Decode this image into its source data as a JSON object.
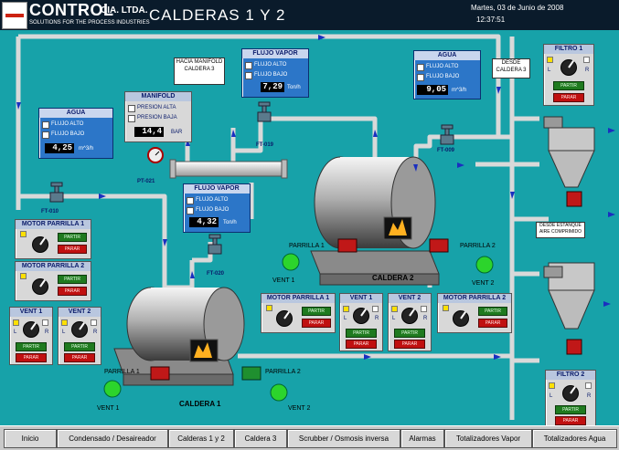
{
  "header": {
    "brand": "CONTROL",
    "brand_suffix": "CIA. LTDA.",
    "tagline": "SOLUTIONS FOR THE PROCESS INDUSTRIES",
    "title": "CALDERAS 1 Y 2",
    "date": "Martes, 03 de Junio de 2008",
    "time": "12:37:51"
  },
  "agua1": {
    "title": "AGUA",
    "opt_alto": "FLUJO ALTO",
    "opt_bajo": "FLUJO BAJO",
    "value": "4,25",
    "unit": "m^3/h"
  },
  "manifold": {
    "title": "MANIFOLD",
    "opt_alta": "PRESION ALTA",
    "opt_baja": "PRESION BAJA",
    "value": "14,4",
    "unit": "BAR"
  },
  "vapor1": {
    "title": "FLUJO VAPOR",
    "opt_alto": "FLUJO ALTO",
    "opt_bajo": "FLUJO BAJO",
    "value": "7,29",
    "unit": "Ton/h"
  },
  "vapor2": {
    "title": "FLUJO VAPOR",
    "opt_alto": "FLUJO ALTO",
    "opt_bajo": "FLUJO BAJO",
    "value": "4,32",
    "unit": "Ton/h"
  },
  "agua2": {
    "title": "AGUA",
    "opt_alto": "FLUJO ALTO",
    "opt_bajo": "FLUJO BAJO",
    "value": "9,05",
    "unit": "m^3/h"
  },
  "notes": {
    "manifold_c3": "HACIA MANIFOLD CALDERA 3",
    "desde_c3": "DESDE CALDERA 3",
    "desde_estanque": "DESDE ESTANQUE AIRE COMPRIMIDO"
  },
  "tags": {
    "ft010": "FT-010",
    "pt021": "PT-021",
    "ft019": "FT-019",
    "ft020": "FT-020",
    "ft009": "FT-009"
  },
  "motors": {
    "mp1_left": "MOTOR PARRILLA 1",
    "mp2_left": "MOTOR PARRILLA 2",
    "vent1_left": "VENT 1",
    "vent2_left": "VENT 2",
    "mp1_mid": "MOTOR PARRILLA 1",
    "vent1_mid": "VENT 1",
    "vent2_mid": "VENT 2",
    "mp2_mid": "MOTOR PARRILLA 2",
    "filtro1": "FILTRO 1",
    "filtro2": "FILTRO 2",
    "partir": "PARTIR",
    "parar": "PARAR",
    "l": "L",
    "r": "R"
  },
  "labels": {
    "caldera1": "CALDERA 1",
    "caldera2": "CALDERA 2",
    "parrilla1": "PARRILLA 1",
    "parrilla2": "PARRILLA 2",
    "vent1": "VENT 1",
    "vent2": "VENT 2"
  },
  "nav": [
    "Inicio",
    "Condensado / Desaireador",
    "Calderas 1 y 2",
    "Caldera 3",
    "Scrubber / Osmosis inversa",
    "Alarmas",
    "Totalizadores Vapor",
    "Totalizadores Agua"
  ],
  "colors": {
    "background": "#17a2a9",
    "pipe": "#d9d9d9",
    "panel_blue": "#2c76c8",
    "run": "#1f7a1f",
    "stop": "#c01010"
  }
}
